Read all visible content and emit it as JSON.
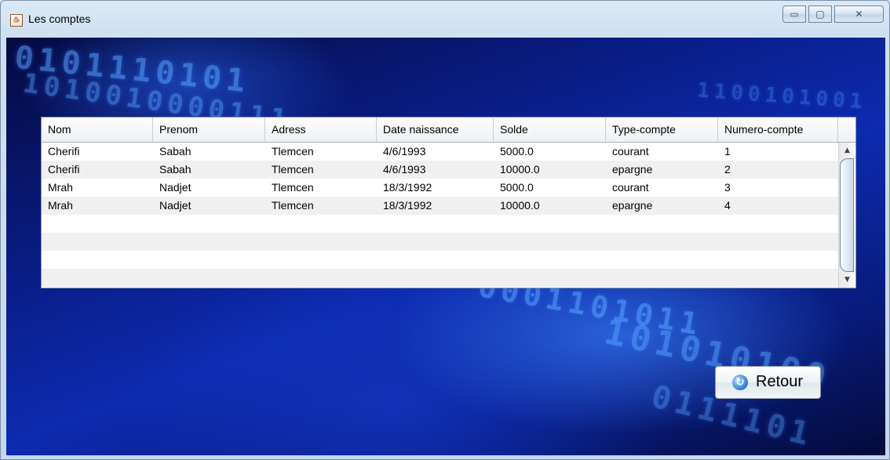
{
  "window": {
    "title": "Les comptes",
    "icon": "java-app-icon",
    "controls": {
      "minimize": "▭",
      "maximize": "▢",
      "close": "✕"
    }
  },
  "table": {
    "columns": [
      "Nom",
      "Prenom",
      "Adress",
      "Date naissance",
      "Solde",
      "Type-compte",
      "Numero-compte"
    ],
    "rows": [
      [
        "Cherifi",
        "Sabah",
        "Tlemcen",
        "4/6/1993",
        "5000.0",
        "courant",
        "1"
      ],
      [
        "Cherifi",
        "Sabah",
        "Tlemcen",
        "4/6/1993",
        "10000.0",
        "epargne",
        "2"
      ],
      [
        "Mrah",
        "Nadjet",
        "Tlemcen",
        "18/3/1992",
        "5000.0",
        "courant",
        "3"
      ],
      [
        "Mrah",
        "Nadjet",
        "Tlemcen",
        "18/3/1992",
        "10000.0",
        "epargne",
        "4"
      ]
    ],
    "scrollbar": {
      "up": "▲",
      "down": "▼"
    }
  },
  "buttons": {
    "retour_label": "Retour",
    "retour_icon": "refresh-icon"
  },
  "colors": {
    "accent": "#2a7ad8",
    "background": "#0d2bb0"
  }
}
